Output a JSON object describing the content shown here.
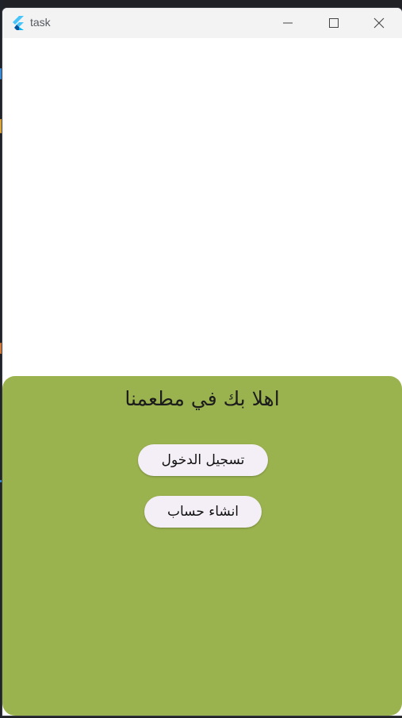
{
  "window": {
    "title": "task"
  },
  "icons": {
    "app": "flutter-logo-icon",
    "minimize": "minimize-icon",
    "maximize": "maximize-icon",
    "close": "close-icon"
  },
  "colors": {
    "sheet": "#9bb34f",
    "button_bg": "#f4eff6",
    "titlebar": "#f3f3f3"
  },
  "main": {
    "welcome_text": "اهلا بك في مطعمنا",
    "login_label": "تسجيل الدخول",
    "signup_label": "انشاء حساب"
  }
}
